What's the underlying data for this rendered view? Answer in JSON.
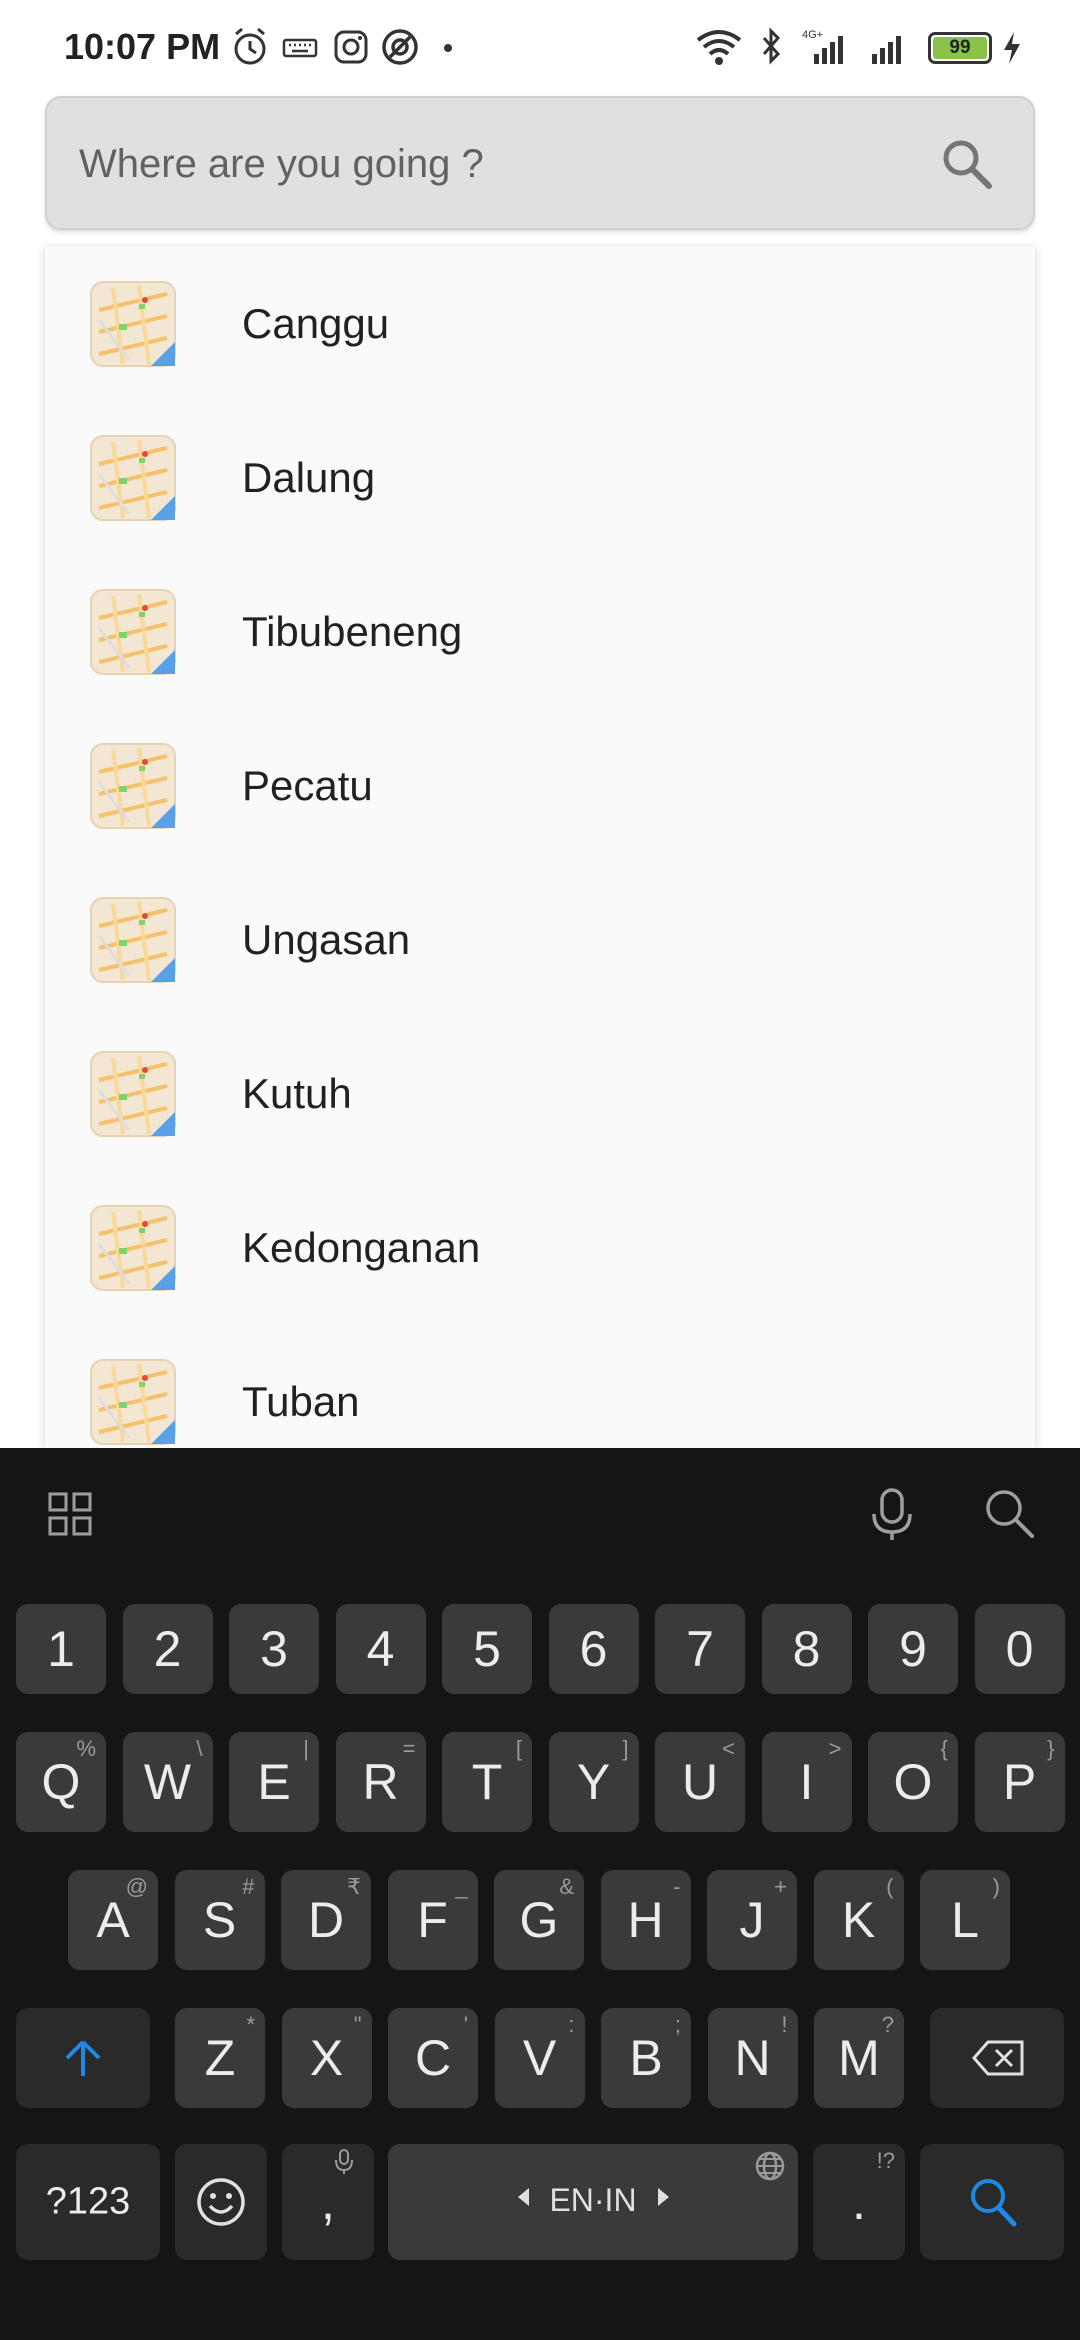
{
  "status_bar": {
    "time": "10:07 PM",
    "battery": "99",
    "network": "4G+"
  },
  "search": {
    "placeholder": "Where are you going ?"
  },
  "suggestions": [
    {
      "label": "Canggu"
    },
    {
      "label": "Dalung"
    },
    {
      "label": "Tibubeneng"
    },
    {
      "label": "Pecatu"
    },
    {
      "label": "Ungasan"
    },
    {
      "label": "Kutuh"
    },
    {
      "label": "Kedonganan"
    },
    {
      "label": "Tuban"
    }
  ],
  "keyboard": {
    "number_row": [
      "1",
      "2",
      "3",
      "4",
      "5",
      "6",
      "7",
      "8",
      "9",
      "0"
    ],
    "row1": [
      {
        "key": "Q",
        "alt": "%"
      },
      {
        "key": "W",
        "alt": "\\"
      },
      {
        "key": "E",
        "alt": "|"
      },
      {
        "key": "R",
        "alt": "="
      },
      {
        "key": "T",
        "alt": "["
      },
      {
        "key": "Y",
        "alt": "]"
      },
      {
        "key": "U",
        "alt": "<"
      },
      {
        "key": "I",
        "alt": ">"
      },
      {
        "key": "O",
        "alt": "{"
      },
      {
        "key": "P",
        "alt": "}"
      }
    ],
    "row2": [
      {
        "key": "A",
        "alt": "@"
      },
      {
        "key": "S",
        "alt": "#"
      },
      {
        "key": "D",
        "alt": "₹"
      },
      {
        "key": "F",
        "alt": "_"
      },
      {
        "key": "G",
        "alt": "&"
      },
      {
        "key": "H",
        "alt": "-"
      },
      {
        "key": "J",
        "alt": "+"
      },
      {
        "key": "K",
        "alt": "("
      },
      {
        "key": "L",
        "alt": ")"
      }
    ],
    "row3": [
      {
        "key": "Z",
        "alt": "*"
      },
      {
        "key": "X",
        "alt": "\""
      },
      {
        "key": "C",
        "alt": "'"
      },
      {
        "key": "V",
        "alt": ":"
      },
      {
        "key": "B",
        "alt": ";"
      },
      {
        "key": "N",
        "alt": "!"
      },
      {
        "key": "M",
        "alt": "?"
      }
    ],
    "symbols_label": "?123",
    "comma": ",",
    "space_label": "EN·IN",
    "period": ".",
    "period_alt": "!?"
  },
  "colors": {
    "accent": "#1e88e5",
    "keyboard_bg": "#151515",
    "key_bg": "#3a3a3a"
  }
}
